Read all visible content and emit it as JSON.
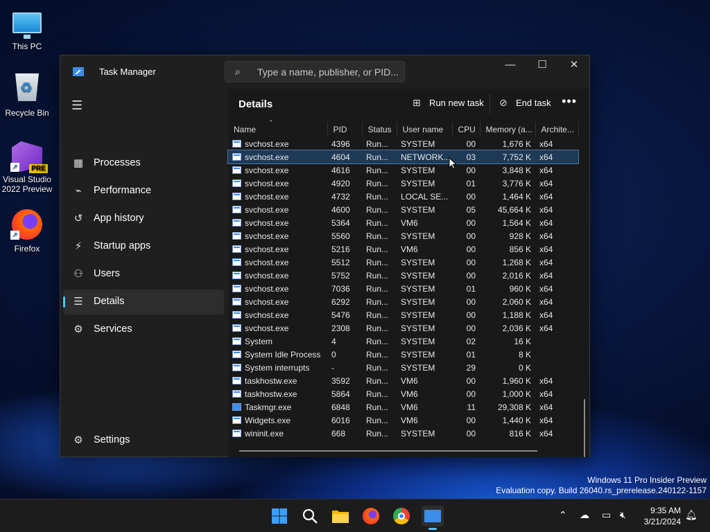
{
  "desktop": {
    "icons": [
      {
        "label": "This PC"
      },
      {
        "label": "Recycle Bin"
      },
      {
        "label": "Visual Studio 2022 Preview",
        "badge": "PRE"
      },
      {
        "label": "Firefox"
      }
    ]
  },
  "window": {
    "title": "Task Manager",
    "search_placeholder": "Type a name, publisher, or PID...",
    "controls": {
      "minimize": "—",
      "maximize": "☐",
      "close": "✕"
    }
  },
  "sidebar": {
    "items": [
      {
        "label": "Processes",
        "icon": "processes-icon",
        "glyph": "▦"
      },
      {
        "label": "Performance",
        "icon": "performance-icon",
        "glyph": "⌁"
      },
      {
        "label": "App history",
        "icon": "history-icon",
        "glyph": "↺"
      },
      {
        "label": "Startup apps",
        "icon": "startup-icon",
        "glyph": "⚡"
      },
      {
        "label": "Users",
        "icon": "users-icon",
        "glyph": "⚇"
      },
      {
        "label": "Details",
        "icon": "details-icon",
        "glyph": "☰",
        "selected": true
      },
      {
        "label": "Services",
        "icon": "services-icon",
        "glyph": "⚙"
      }
    ],
    "settings": "Settings"
  },
  "toolbar": {
    "title": "Details",
    "run_new_task": "Run new task",
    "end_task": "End task",
    "more": "•••"
  },
  "table": {
    "columns": [
      "Name",
      "PID",
      "Status",
      "User name",
      "CPU",
      "Memory (a...",
      "Archite..."
    ],
    "rows": [
      {
        "name": "svchost.exe",
        "pid": "4396",
        "status": "Run...",
        "user": "SYSTEM",
        "cpu": "00",
        "mem": "1,676 K",
        "arch": "x64"
      },
      {
        "name": "svchost.exe",
        "pid": "4604",
        "status": "Run...",
        "user": "NETWORK...",
        "cpu": "03",
        "mem": "7,752 K",
        "arch": "x64",
        "selected": true
      },
      {
        "name": "svchost.exe",
        "pid": "4616",
        "status": "Run...",
        "user": "SYSTEM",
        "cpu": "00",
        "mem": "3,848 K",
        "arch": "x64"
      },
      {
        "name": "svchost.exe",
        "pid": "4920",
        "status": "Run...",
        "user": "SYSTEM",
        "cpu": "01",
        "mem": "3,776 K",
        "arch": "x64"
      },
      {
        "name": "svchost.exe",
        "pid": "4732",
        "status": "Run...",
        "user": "LOCAL SE...",
        "cpu": "00",
        "mem": "1,464 K",
        "arch": "x64"
      },
      {
        "name": "svchost.exe",
        "pid": "4600",
        "status": "Run...",
        "user": "SYSTEM",
        "cpu": "05",
        "mem": "45,664 K",
        "arch": "x64"
      },
      {
        "name": "svchost.exe",
        "pid": "5364",
        "status": "Run...",
        "user": "VM6",
        "cpu": "00",
        "mem": "1,564 K",
        "arch": "x64"
      },
      {
        "name": "svchost.exe",
        "pid": "5560",
        "status": "Run...",
        "user": "SYSTEM",
        "cpu": "00",
        "mem": "928 K",
        "arch": "x64"
      },
      {
        "name": "svchost.exe",
        "pid": "5216",
        "status": "Run...",
        "user": "VM6",
        "cpu": "00",
        "mem": "856 K",
        "arch": "x64"
      },
      {
        "name": "svchost.exe",
        "pid": "5512",
        "status": "Run...",
        "user": "SYSTEM",
        "cpu": "00",
        "mem": "1,268 K",
        "arch": "x64"
      },
      {
        "name": "svchost.exe",
        "pid": "5752",
        "status": "Run...",
        "user": "SYSTEM",
        "cpu": "00",
        "mem": "2,016 K",
        "arch": "x64"
      },
      {
        "name": "svchost.exe",
        "pid": "7036",
        "status": "Run...",
        "user": "SYSTEM",
        "cpu": "01",
        "mem": "960 K",
        "arch": "x64"
      },
      {
        "name": "svchost.exe",
        "pid": "6292",
        "status": "Run...",
        "user": "SYSTEM",
        "cpu": "00",
        "mem": "2,060 K",
        "arch": "x64"
      },
      {
        "name": "svchost.exe",
        "pid": "5476",
        "status": "Run...",
        "user": "SYSTEM",
        "cpu": "00",
        "mem": "1,188 K",
        "arch": "x64"
      },
      {
        "name": "svchost.exe",
        "pid": "2308",
        "status": "Run...",
        "user": "SYSTEM",
        "cpu": "00",
        "mem": "2,036 K",
        "arch": "x64"
      },
      {
        "name": "System",
        "pid": "4",
        "status": "Run...",
        "user": "SYSTEM",
        "cpu": "02",
        "mem": "16 K",
        "arch": ""
      },
      {
        "name": "System Idle Process",
        "pid": "0",
        "status": "Run...",
        "user": "SYSTEM",
        "cpu": "01",
        "mem": "8 K",
        "arch": ""
      },
      {
        "name": "System interrupts",
        "pid": "-",
        "status": "Run...",
        "user": "SYSTEM",
        "cpu": "29",
        "mem": "0 K",
        "arch": ""
      },
      {
        "name": "taskhostw.exe",
        "pid": "3592",
        "status": "Run...",
        "user": "VM6",
        "cpu": "00",
        "mem": "1,960 K",
        "arch": "x64"
      },
      {
        "name": "taskhostw.exe",
        "pid": "5864",
        "status": "Run...",
        "user": "VM6",
        "cpu": "00",
        "mem": "1,000 K",
        "arch": "x64"
      },
      {
        "name": "Taskmgr.exe",
        "pid": "6848",
        "status": "Run...",
        "user": "VM6",
        "cpu": "11",
        "mem": "29,308 K",
        "arch": "x64"
      },
      {
        "name": "Widgets.exe",
        "pid": "6016",
        "status": "Run...",
        "user": "VM6",
        "cpu": "00",
        "mem": "1,440 K",
        "arch": "x64"
      },
      {
        "name": "wininit.exe",
        "pid": "668",
        "status": "Run...",
        "user": "SYSTEM",
        "cpu": "00",
        "mem": "816 K",
        "arch": "x64"
      }
    ]
  },
  "watermark": {
    "line1": "Windows 11 Pro Insider Preview",
    "line2": "Evaluation copy. Build 26040.rs_prerelease.240122-1157"
  },
  "taskbar": {
    "time": "9:35 AM",
    "date": "3/21/2024"
  },
  "colors": {
    "accent": "#4cc2ff",
    "selection": "#1e3a57",
    "window_bg": "#1f1f1f"
  }
}
